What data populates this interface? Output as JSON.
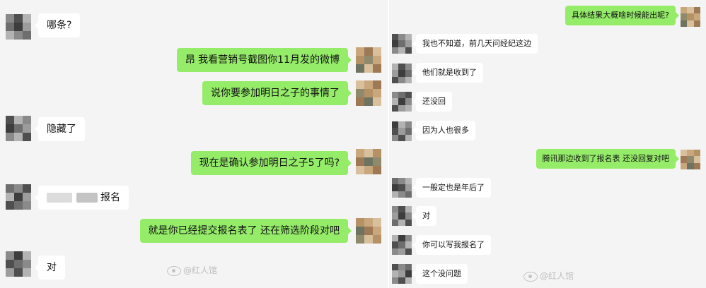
{
  "left_chat": {
    "messages": [
      {
        "side": "in",
        "text": "哪条?"
      },
      {
        "side": "out",
        "text": "昂 我看营销号截图你11月发的微博"
      },
      {
        "side": "out",
        "text": "说你要参加明日之子的事情了"
      },
      {
        "side": "in",
        "text": "隐藏了"
      },
      {
        "side": "out",
        "text": "现在是确认参加明日之子5了吗?"
      },
      {
        "side": "in",
        "text": "报名",
        "has_redaction": true
      },
      {
        "side": "out",
        "text": "就是你已经提交报名表了 还在筛选阶段对吧"
      },
      {
        "side": "in",
        "text": "对"
      }
    ],
    "watermark": "@红人馆"
  },
  "right_chat": {
    "messages": [
      {
        "side": "out",
        "text": "具体结果大概啥时候能出呢?"
      },
      {
        "side": "in",
        "text": "我也不知道，前几天问经纪这边"
      },
      {
        "side": "in",
        "text": "他们就是收到了"
      },
      {
        "side": "in",
        "text": "还没回"
      },
      {
        "side": "in",
        "text": "因为人也很多"
      },
      {
        "side": "out",
        "text": "腾讯那边收到了报名表 还没回复对吧"
      },
      {
        "side": "in",
        "text": "一般定也是年后了"
      },
      {
        "side": "in",
        "text": "对"
      },
      {
        "side": "in",
        "text": "你可以写我报名了"
      },
      {
        "side": "in",
        "text": "这个没问题"
      }
    ],
    "watermark": "@红人馆"
  },
  "icons": {
    "avatar_other": "pixelated-avatar-icon",
    "avatar_self": "pixelated-avatar-icon",
    "weibo": "weibo-logo-icon"
  },
  "colors": {
    "outgoing_bubble": "#95ec69",
    "incoming_bubble": "#ffffff",
    "background": "#f4f4f4"
  }
}
